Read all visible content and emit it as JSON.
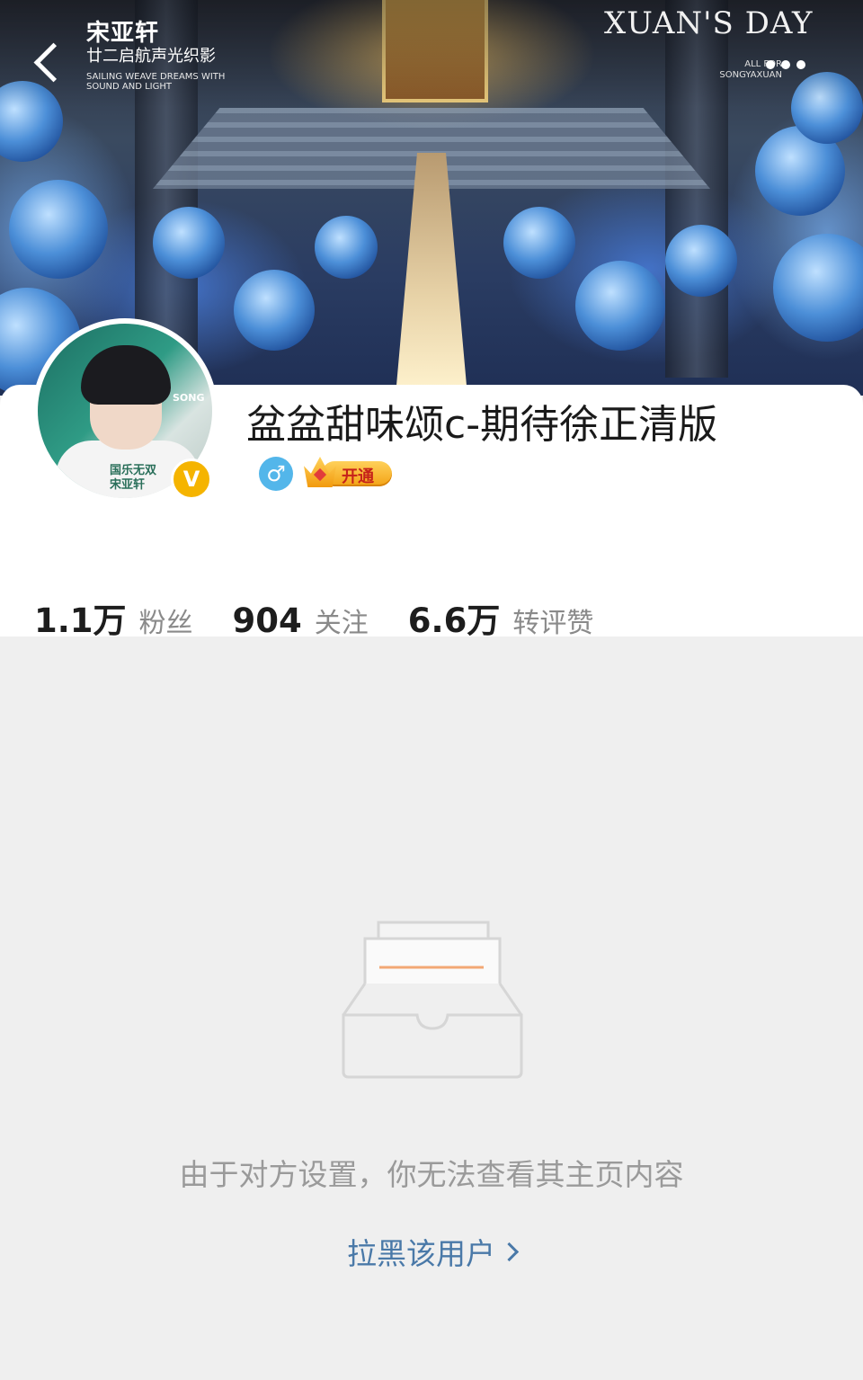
{
  "cover": {
    "title_cn": "宋亚轩",
    "subtitle_cn": "廿二启航声光织影",
    "tagline_en": "SAILING WEAVE DREAMS WITH SOUND AND LIGHT",
    "right_title": "XUAN'S DAY",
    "right_subtitle": "ALL FOR SONGYAXUAN"
  },
  "header": {
    "back_icon": "chevron-left-icon",
    "more_icon": "more-dots-icon"
  },
  "profile": {
    "username": "盆盆甜味颂c-期待徐正清版",
    "avatar_text_top": "SONG",
    "avatar_caption": "国乐无双 宋亚轩",
    "verified_badge": "V",
    "gender_symbol": "♂",
    "vip_label": "开通",
    "colors": {
      "verified": "#f5b400",
      "gender": "#53b6ea",
      "vip": "#f3a316"
    }
  },
  "stats": [
    {
      "value": "1.1万",
      "label": "粉丝"
    },
    {
      "value": "904",
      "label": "关注"
    },
    {
      "value": "6.6万",
      "label": "转评赞"
    }
  ],
  "empty_state": {
    "icon": "empty-inbox-icon",
    "message": "由于对方设置，你无法查看其主页内容",
    "block_link": "拉黑该用户"
  }
}
